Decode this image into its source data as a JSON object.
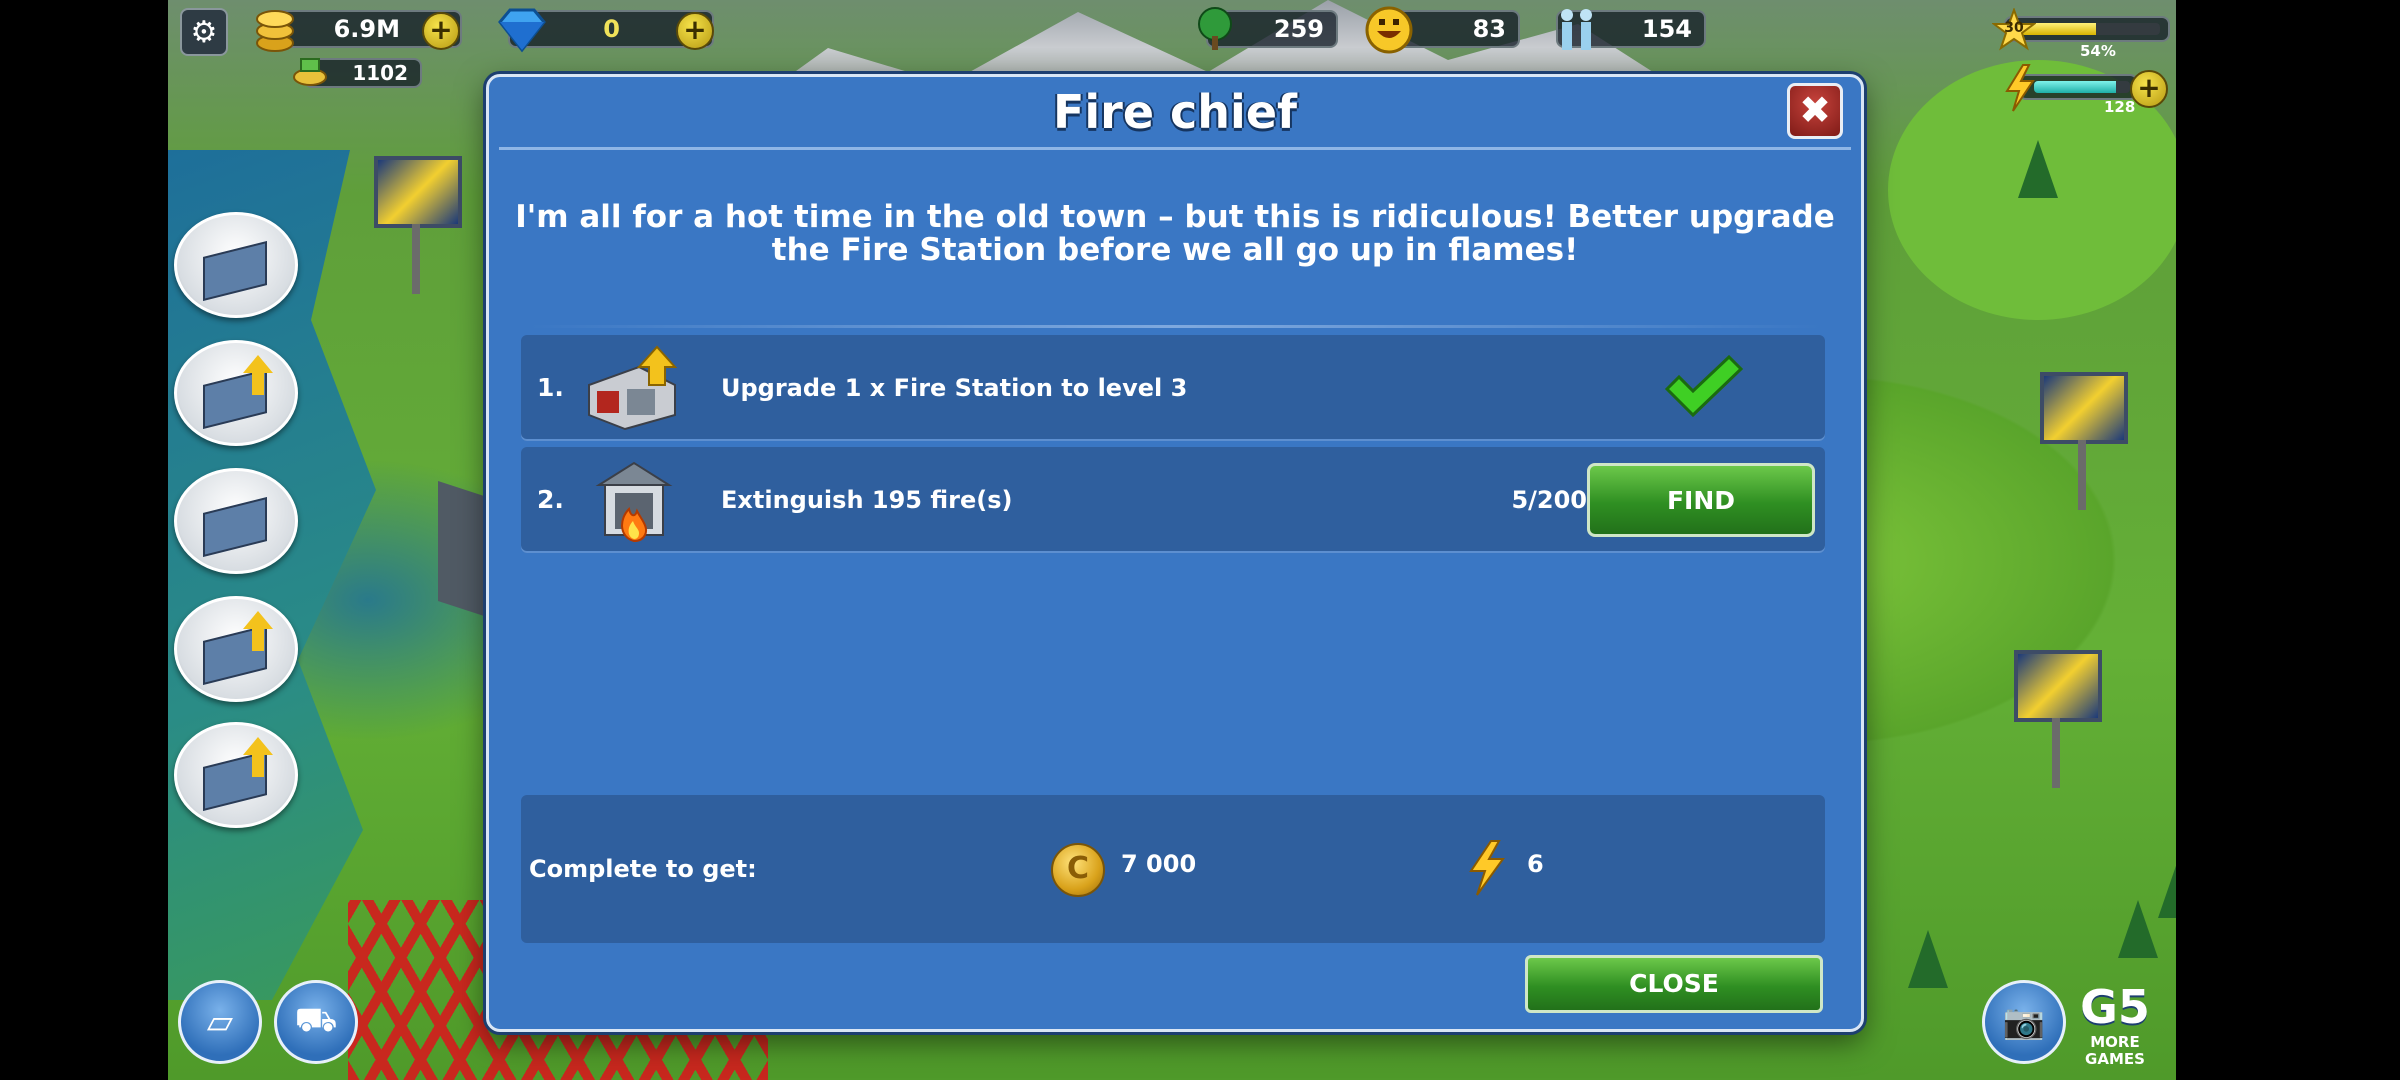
{
  "hud": {
    "coins": "6.9M",
    "cash": "1102",
    "gems": "0",
    "trees": "259",
    "happiness": "83",
    "population": "154",
    "level": "30",
    "xp_percent_label": "54%",
    "xp_fraction": 0.54,
    "energy": "128",
    "energy_fraction": 0.85,
    "plus_symbol": "+"
  },
  "icons": {
    "settings": "gear-icon",
    "coins": "coin-stack-icon",
    "cash": "cash-icon",
    "gem": "diamond-icon",
    "tree": "tree-icon",
    "happiness": "smiley-icon",
    "population": "people-icon",
    "level": "star-icon",
    "energy": "lightning-icon"
  },
  "modal": {
    "title": "Fire chief",
    "close_symbol": "✖",
    "message": "I'm all for a hot time in the old town – but this is ridiculous! Better upgrade the Fire Station before we all go up in flames!",
    "tasks": [
      {
        "number": "1.",
        "text": "Upgrade 1 x Fire Station to level 3",
        "completed": true
      },
      {
        "number": "2.",
        "text": "Extinguish 195 fire(s)",
        "progress": "5/200",
        "button": "FIND"
      }
    ],
    "reward_label": "Complete to get:",
    "reward_coins": "7 000",
    "reward_coin_symbol": "C",
    "reward_energy": "6",
    "close_button": "CLOSE"
  },
  "bottom": {
    "g5_logo": "G5",
    "more_games": "MORE GAMES"
  },
  "colors": {
    "modal_bg": "#3a77c4",
    "row_bg": "#2f5f9e",
    "button_green": "#2f8f22",
    "close_red": "#c7433c"
  }
}
